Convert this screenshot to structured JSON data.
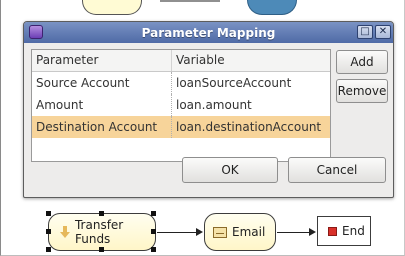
{
  "dialog": {
    "title": "Parameter Mapping",
    "window_buttons": {
      "restore": "□",
      "close": "✕"
    },
    "table": {
      "columns": [
        "Parameter",
        "Variable"
      ],
      "rows": [
        {
          "parameter": "Source Account",
          "variable": "loanSourceAccount",
          "selected": false
        },
        {
          "parameter": "Amount",
          "variable": "loan.amount",
          "selected": false
        },
        {
          "parameter": "Destination Account",
          "variable": "loan.destinationAccount",
          "selected": true
        }
      ]
    },
    "buttons": {
      "add": "Add",
      "remove": "Remove",
      "ok": "OK",
      "cancel": "Cancel"
    }
  },
  "workflow": {
    "nodes": [
      {
        "label": "Transfer Funds",
        "icon": "down-arrow-icon"
      },
      {
        "label": "Email",
        "icon": "mail-icon"
      },
      {
        "label": "End",
        "icon": "stop-icon"
      }
    ]
  },
  "colors": {
    "titlebar": "#5d76b0",
    "selection": "#f7d49a",
    "node_fill": "#fff6c8",
    "end_marker": "#d9302a"
  }
}
